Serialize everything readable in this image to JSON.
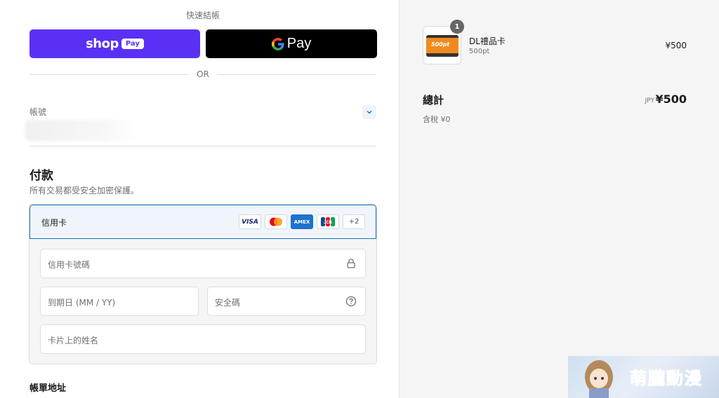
{
  "express": {
    "label": "快速結帳",
    "shop_pay": {
      "word": "shop",
      "pill": "Pay",
      "color": "#5a31f4"
    },
    "gpay": {
      "word": "Pay"
    },
    "or": "OR"
  },
  "account": {
    "label": "帳號",
    "chevron_icon": "chevron-down-icon"
  },
  "payment": {
    "title": "付款",
    "subtitle": "所有交易都受安全加密保護。",
    "method_label": "信用卡",
    "brands": [
      "VISA",
      "mastercard",
      "AMEX",
      "JCB",
      "+2"
    ],
    "fields": {
      "card_number": {
        "placeholder": "信用卡號碼",
        "icon": "lock-icon"
      },
      "expiry": {
        "placeholder": "到期日 (MM / YY)"
      },
      "cvc": {
        "placeholder": "安全碼",
        "icon": "help-circle-icon"
      },
      "name": {
        "placeholder": "卡片上的姓名"
      }
    }
  },
  "billing": {
    "title": "帳單地址"
  },
  "summary": {
    "item": {
      "quantity": "1",
      "name": "DL禮品卡",
      "variant": "500pt",
      "price": "¥500",
      "image_text": "500pt"
    },
    "total_label": "總計",
    "currency": "JPY",
    "total": "¥500",
    "tax": "含稅 ¥0"
  },
  "watermark": {
    "text": "萌朧動漫"
  }
}
